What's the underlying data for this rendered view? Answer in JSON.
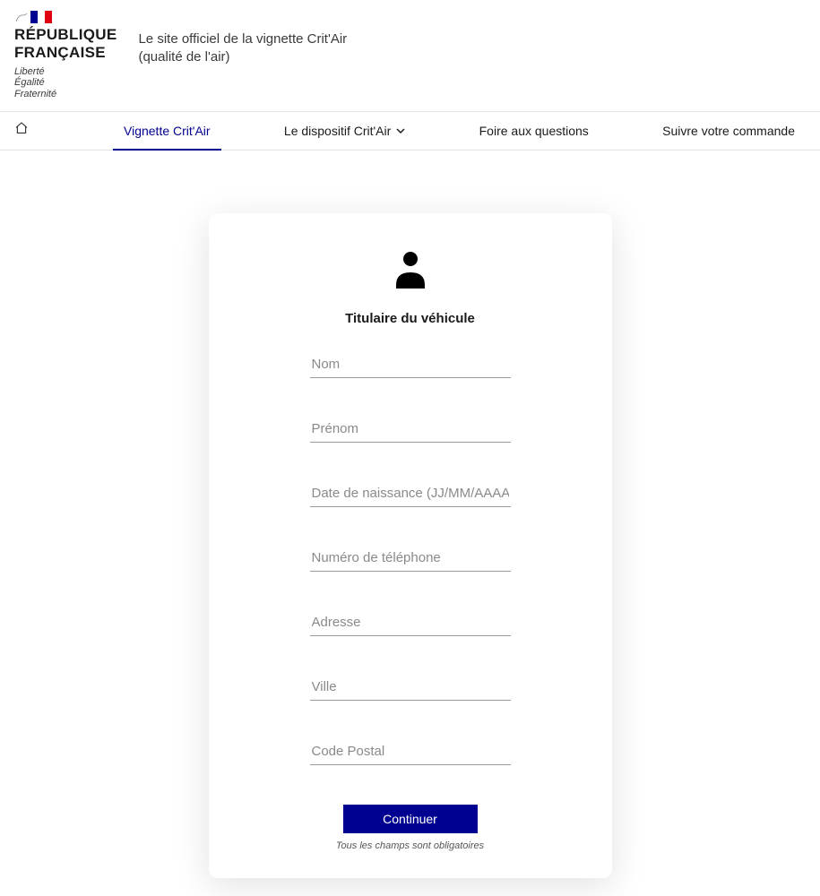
{
  "header": {
    "logo_line1": "RÉPUBLIQUE",
    "logo_line2": "FRANÇAISE",
    "motto1": "Liberté",
    "motto2": "Égalité",
    "motto3": "Fraternité",
    "site_title_line1": "Le site officiel de la vignette Crit'Air",
    "site_title_line2": "(qualité de l'air)"
  },
  "nav": {
    "vignette": "Vignette Crit'Air",
    "dispositif": "Le dispositif Crit'Air",
    "faq": "Foire aux questions",
    "suivre": "Suivre votre commande"
  },
  "form": {
    "title": "Titulaire du véhicule",
    "fields": {
      "nom": "Nom",
      "prenom": "Prénom",
      "dob": "Date de naissance (JJ/MM/AAAA)",
      "tel": "Numéro de téléphone",
      "adresse": "Adresse",
      "ville": "Ville",
      "cp": "Code Postal"
    },
    "submit": "Continuer",
    "note": "Tous les champs sont obligatoires"
  }
}
